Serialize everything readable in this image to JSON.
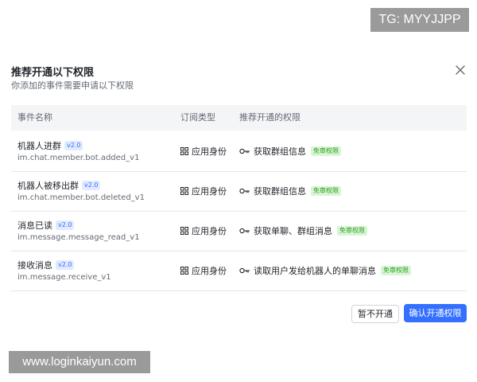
{
  "overlay": {
    "tg_badge": "TG: MYYJJPP",
    "watermark": "www.loginkaiyun.com"
  },
  "dialog": {
    "title": "推荐开通以下权限",
    "subtitle": "你添加的事件需要申请以下权限",
    "close_icon": "close-icon"
  },
  "table": {
    "headers": [
      "事件名称",
      "订阅类型",
      "推荐开通的权限"
    ],
    "rows": [
      {
        "event_name": "机器人进群",
        "version": "v2.0",
        "event_id": "im.chat.member.bot.added_v1",
        "identity": "应用身份",
        "permission": "获取群组信息",
        "badge": "免审权限"
      },
      {
        "event_name": "机器人被移出群",
        "version": "v2.0",
        "event_id": "im.chat.member.bot.deleted_v1",
        "identity": "应用身份",
        "permission": "获取群组信息",
        "badge": "免审权限"
      },
      {
        "event_name": "消息已读",
        "version": "v2.0",
        "event_id": "im.message.message_read_v1",
        "identity": "应用身份",
        "permission": "获取单聊、群组消息",
        "badge": "免审权限"
      },
      {
        "event_name": "接收消息",
        "version": "v2.0",
        "event_id": "im.message.receive_v1",
        "identity": "应用身份",
        "permission": "读取用户发给机器人的单聊消息",
        "badge": "免审权限"
      }
    ]
  },
  "footer": {
    "cancel_label": "暂不开通",
    "confirm_label": "确认开通权限"
  },
  "colors": {
    "primary": "#3370ff",
    "version_badge_bg": "#e1eaff",
    "free_badge_text": "#2ea121",
    "free_badge_bg": "#d9f5d6"
  }
}
